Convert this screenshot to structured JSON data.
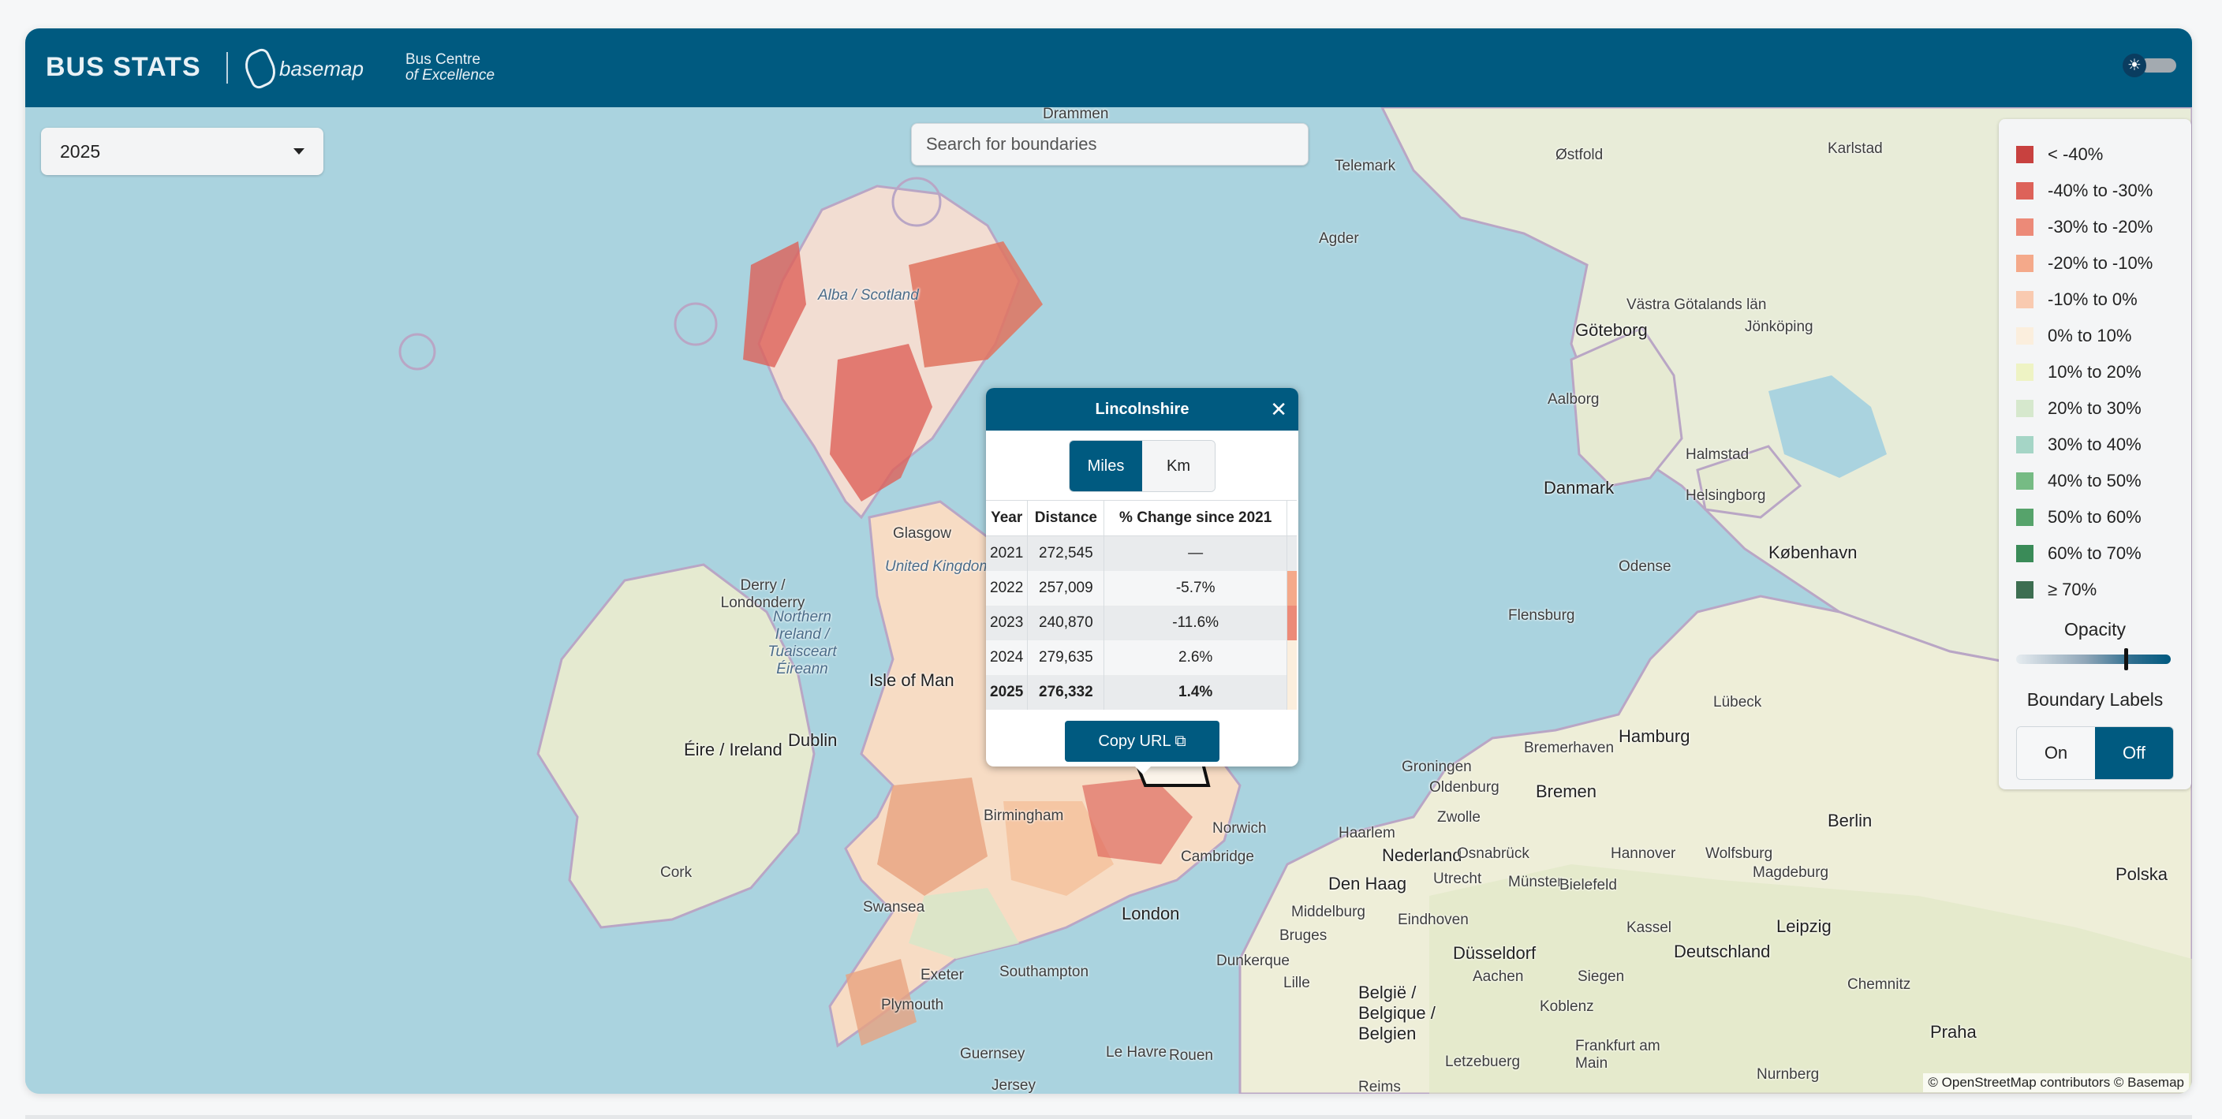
{
  "header": {
    "brand_title": "BUS STATS",
    "partner_name": "basemap",
    "bce_line1": "Bus Centre",
    "bce_line2": "of Excellence",
    "theme_icon": "sun-icon"
  },
  "year_select": {
    "value": "2025"
  },
  "search": {
    "placeholder": "Search for boundaries"
  },
  "legend": {
    "items": [
      {
        "label": "< -40%",
        "color": "#c8413f"
      },
      {
        "label": "-40% to -30%",
        "color": "#dd6259"
      },
      {
        "label": "-30% to -20%",
        "color": "#ec8a78"
      },
      {
        "label": "-20% to -10%",
        "color": "#f4a98a"
      },
      {
        "label": "-10% to 0%",
        "color": "#f9cab0"
      },
      {
        "label": "0% to 10%",
        "color": "#fbeedd"
      },
      {
        "label": "10% to 20%",
        "color": "#eef3c4"
      },
      {
        "label": "20% to 30%",
        "color": "#d6e8cd"
      },
      {
        "label": "30% to 40%",
        "color": "#a5d5c6"
      },
      {
        "label": "40% to 50%",
        "color": "#76bb84"
      },
      {
        "label": "50% to 60%",
        "color": "#56a36b"
      },
      {
        "label": "60% to 70%",
        "color": "#3a8b58"
      },
      {
        "label": "≥ 70%",
        "color": "#3d6e51"
      }
    ],
    "opacity_title": "Opacity",
    "opacity_value": 0.75,
    "labels_title": "Boundary Labels",
    "labels_on": "On",
    "labels_off": "Off"
  },
  "popup": {
    "title": "Lincolnshire",
    "unit_miles": "Miles",
    "unit_km": "Km",
    "columns": [
      "Year",
      "Distance",
      "% Change since 2021"
    ],
    "rows": [
      {
        "year": "2021",
        "distance": "272,545",
        "change": "—",
        "bar_color": ""
      },
      {
        "year": "2022",
        "distance": "257,009",
        "change": "-5.7%",
        "bar_color": "#f4a98a"
      },
      {
        "year": "2023",
        "distance": "240,870",
        "change": "-11.6%",
        "bar_color": "#ec8a78"
      },
      {
        "year": "2024",
        "distance": "279,635",
        "change": "2.6%",
        "bar_color": "#fbeedd"
      },
      {
        "year": "2025",
        "distance": "276,332",
        "change": "1.4%",
        "bar_color": "#fbeedd"
      }
    ],
    "copy_url": "Copy URL"
  },
  "map_labels": [
    {
      "text": "Drammen"
    },
    {
      "text": "Telemark"
    },
    {
      "text": "Østfold"
    },
    {
      "text": "Karlstad"
    },
    {
      "text": "Agder"
    },
    {
      "text": "Västra Götalands län"
    },
    {
      "text": "Göteborg"
    },
    {
      "text": "Jönköping"
    },
    {
      "text": "Aalborg"
    },
    {
      "text": "Danmark"
    },
    {
      "text": "Halmstad"
    },
    {
      "text": "Helsingborg"
    },
    {
      "text": "København"
    },
    {
      "text": "Odense"
    },
    {
      "text": "Flensburg"
    },
    {
      "text": "Lübeck"
    },
    {
      "text": "Hamburg"
    },
    {
      "text": "Bremen"
    },
    {
      "text": "Groningen"
    },
    {
      "text": "Bremerhaven"
    },
    {
      "text": "Oldenburg"
    },
    {
      "text": "Berlin"
    },
    {
      "text": "Nederland"
    },
    {
      "text": "Hannover"
    },
    {
      "text": "Zwolle"
    },
    {
      "text": "Osnabrück"
    },
    {
      "text": "Wolfsburg"
    },
    {
      "text": "Magdeburg"
    },
    {
      "text": "Haarlem"
    },
    {
      "text": "Den Haag"
    },
    {
      "text": "Utrecht"
    },
    {
      "text": "Münster"
    },
    {
      "text": "Bielefeld"
    },
    {
      "text": "Middelburg"
    },
    {
      "text": "Eindhoven"
    },
    {
      "text": "Kassel"
    },
    {
      "text": "Leipzig"
    },
    {
      "text": "Deutschland"
    },
    {
      "text": "Bruges"
    },
    {
      "text": "Düsseldorf"
    },
    {
      "text": "Aachen"
    },
    {
      "text": "Siegen"
    },
    {
      "text": "Chemnitz"
    },
    {
      "text": "Lille"
    },
    {
      "text": "België / Belgique / Belgien"
    },
    {
      "text": "Koblenz"
    },
    {
      "text": "Frankfurt am Main"
    },
    {
      "text": "Praha"
    },
    {
      "text": "Polska"
    },
    {
      "text": "Letzebuerg"
    },
    {
      "text": "Nurnberg"
    },
    {
      "text": "Reims"
    },
    {
      "text": "Rouen"
    },
    {
      "text": "Le Havre"
    },
    {
      "text": "Guernsey"
    },
    {
      "text": "Jersey"
    },
    {
      "text": "Alba / Scotland"
    },
    {
      "text": "Glasgow"
    },
    {
      "text": "United Kingdom"
    },
    {
      "text": "Derry / Londonderry"
    },
    {
      "text": "Northern Ireland / Tuaisceart Éireann"
    },
    {
      "text": "Isle of Man"
    },
    {
      "text": "Éire / Ireland"
    },
    {
      "text": "Dublin"
    },
    {
      "text": "Cork"
    },
    {
      "text": "Birmingham"
    },
    {
      "text": "Swansea"
    },
    {
      "text": "Exeter"
    },
    {
      "text": "Plymouth"
    },
    {
      "text": "Southampton"
    },
    {
      "text": "London"
    },
    {
      "text": "Dunkerque"
    },
    {
      "text": "Cambridge"
    },
    {
      "text": "Norwich"
    }
  ],
  "attribution": "© OpenStreetMap contributors © Basemap"
}
